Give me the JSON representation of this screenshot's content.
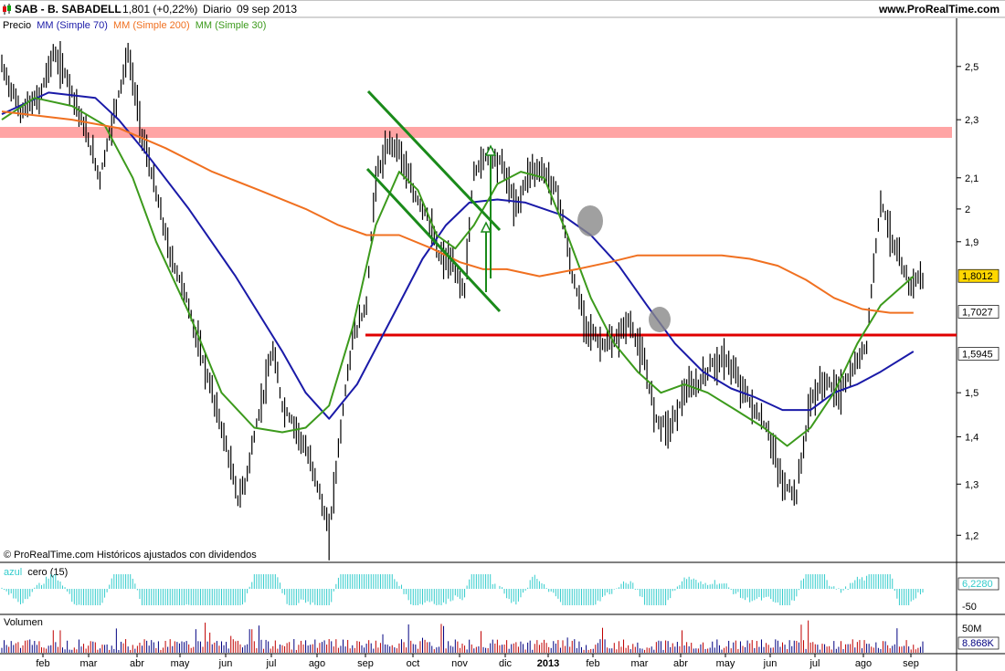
{
  "header": {
    "ticker": "SAB - B. SABADELL",
    "last": "1,801 (+0,22%)",
    "period": "Diario",
    "date": "09 sep 2013",
    "site": "www.ProRealTime.com"
  },
  "legend": {
    "price": "Precio",
    "ma70": "MM (Simple 70)",
    "ma200": "MM (Simple 200)",
    "ma30": "MM (Simple 30)"
  },
  "footer_note": "© ProRealTime.com  Históricos ajustados con dividendos",
  "colors": {
    "price": "#000000",
    "ma70": "#1a1aa8",
    "ma200": "#f07020",
    "ma30": "#3c9a1c",
    "resistance_band": "#ff9a9a",
    "support_line": "#e00000",
    "triangle": "#1a8a1a",
    "oscillator": "#33cccc",
    "volume": "#000080"
  },
  "chart_data": [
    {
      "type": "line",
      "title": "SAB - B. SABADELL",
      "ylim": [
        1.16,
        2.62
      ],
      "y_scale": "log",
      "yticks": [
        {
          "value": 2.5,
          "label": "2,5"
        },
        {
          "value": 2.3,
          "label": "2,3"
        },
        {
          "value": 2.1,
          "label": "2,1"
        },
        {
          "value": 2.0,
          "label": "2"
        },
        {
          "value": 1.9,
          "label": "1,9"
        },
        {
          "value": 1.5,
          "label": "1,5"
        },
        {
          "value": 1.4,
          "label": "1,4"
        },
        {
          "value": 1.3,
          "label": "1,3"
        },
        {
          "value": 1.2,
          "label": "1,2"
        }
      ],
      "price_labels": [
        {
          "value": 1.801,
          "label": "1,8012",
          "color": "#ffd700"
        },
        {
          "value": 1.7027,
          "label": "1,7027",
          "color": "#ffffff"
        },
        {
          "value": 1.5945,
          "label": "1,5945",
          "color": "#ffffff"
        }
      ],
      "x_labels": [
        "feb",
        "mar",
        "abr",
        "may",
        "jun",
        "jul",
        "ago",
        "sep",
        "oct",
        "nov",
        "dic",
        "2013",
        "feb",
        "mar",
        "abr",
        "may",
        "jun",
        "jul",
        "ago",
        "sep"
      ],
      "grid": false,
      "series": [
        {
          "name": "Precio",
          "x": [
            0,
            8,
            16,
            22,
            28,
            36,
            42,
            48,
            54,
            60,
            66,
            72,
            78,
            84,
            90,
            96,
            101,
            104,
            108,
            116,
            120,
            126,
            134,
            140,
            146,
            150,
            156,
            160,
            166,
            170,
            176,
            182,
            187,
            192,
            198,
            202,
            208,
            214,
            220,
            226,
            232,
            238,
            244,
            250,
            256,
            262,
            268,
            274,
            280,
            286,
            292,
            298,
            304,
            310,
            316,
            322,
            328,
            334,
            340,
            346,
            352,
            358,
            364,
            370,
            376,
            382,
            388,
            394
          ],
          "y": [
            2.5,
            2.33,
            2.38,
            2.55,
            2.46,
            2.25,
            2.1,
            2.32,
            2.55,
            2.25,
            2.05,
            1.86,
            1.76,
            1.62,
            1.5,
            1.38,
            1.27,
            1.3,
            1.4,
            1.6,
            1.47,
            1.42,
            1.32,
            1.2,
            1.46,
            1.63,
            1.72,
            2.1,
            2.22,
            2.2,
            2.05,
            1.98,
            1.86,
            1.84,
            1.76,
            2.12,
            2.18,
            2.15,
            2.0,
            2.13,
            2.12,
            2.05,
            1.8,
            1.67,
            1.62,
            1.62,
            1.68,
            1.59,
            1.44,
            1.42,
            1.5,
            1.52,
            1.57,
            1.58,
            1.52,
            1.46,
            1.41,
            1.3,
            1.28,
            1.48,
            1.53,
            1.5,
            1.55,
            1.62,
            2.03,
            1.88,
            1.78,
            1.8
          ]
        },
        {
          "name": "MM (Simple 70)",
          "x": [
            0,
            20,
            40,
            50,
            60,
            80,
            100,
            120,
            130,
            140,
            152,
            168,
            180,
            190,
            200,
            212,
            224,
            240,
            252,
            264,
            276,
            288,
            300,
            312,
            322,
            334,
            346,
            356,
            366,
            376,
            390
          ],
          "y": [
            2.32,
            2.4,
            2.38,
            2.3,
            2.2,
            2.0,
            1.8,
            1.6,
            1.5,
            1.44,
            1.52,
            1.7,
            1.85,
            1.95,
            2.02,
            2.03,
            2.02,
            1.98,
            1.92,
            1.83,
            1.72,
            1.62,
            1.55,
            1.51,
            1.49,
            1.46,
            1.46,
            1.5,
            1.52,
            1.55,
            1.6
          ]
        },
        {
          "name": "MM (Simple 200)",
          "x": [
            0,
            30,
            50,
            70,
            90,
            110,
            130,
            144,
            156,
            170,
            184,
            196,
            206,
            216,
            230,
            246,
            260,
            272,
            284,
            296,
            308,
            320,
            332,
            344,
            356,
            368,
            380,
            390
          ],
          "y": [
            2.33,
            2.3,
            2.27,
            2.2,
            2.12,
            2.06,
            2.0,
            1.95,
            1.92,
            1.92,
            1.88,
            1.84,
            1.82,
            1.82,
            1.8,
            1.82,
            1.84,
            1.86,
            1.86,
            1.86,
            1.86,
            1.85,
            1.83,
            1.79,
            1.74,
            1.71,
            1.7,
            1.7
          ]
        },
        {
          "name": "MM (Simple 30)",
          "x": [
            0,
            14,
            30,
            44,
            56,
            66,
            80,
            94,
            108,
            120,
            130,
            140,
            150,
            160,
            170,
            178,
            186,
            194,
            202,
            212,
            222,
            232,
            242,
            252,
            262,
            272,
            282,
            292,
            302,
            314,
            326,
            336,
            346,
            356,
            366,
            376,
            390
          ],
          "y": [
            2.3,
            2.38,
            2.35,
            2.28,
            2.1,
            1.9,
            1.7,
            1.5,
            1.42,
            1.41,
            1.42,
            1.47,
            1.66,
            1.95,
            2.12,
            2.06,
            1.92,
            1.88,
            1.95,
            2.08,
            2.12,
            2.1,
            1.92,
            1.74,
            1.62,
            1.55,
            1.5,
            1.52,
            1.5,
            1.46,
            1.42,
            1.38,
            1.42,
            1.5,
            1.62,
            1.72,
            1.8
          ]
        }
      ]
    },
    {
      "type": "bar",
      "title": "azul cero (15)",
      "label_name": "azul",
      "label_rest": "cero (15)",
      "yticks": [
        {
          "value": 6.228,
          "label": "6,2280"
        },
        {
          "value": -50,
          "label": "-50"
        }
      ]
    },
    {
      "type": "bar",
      "title": "Volumen",
      "yticks": [
        {
          "label": "50M"
        },
        {
          "label": "8.868K"
        }
      ]
    }
  ]
}
